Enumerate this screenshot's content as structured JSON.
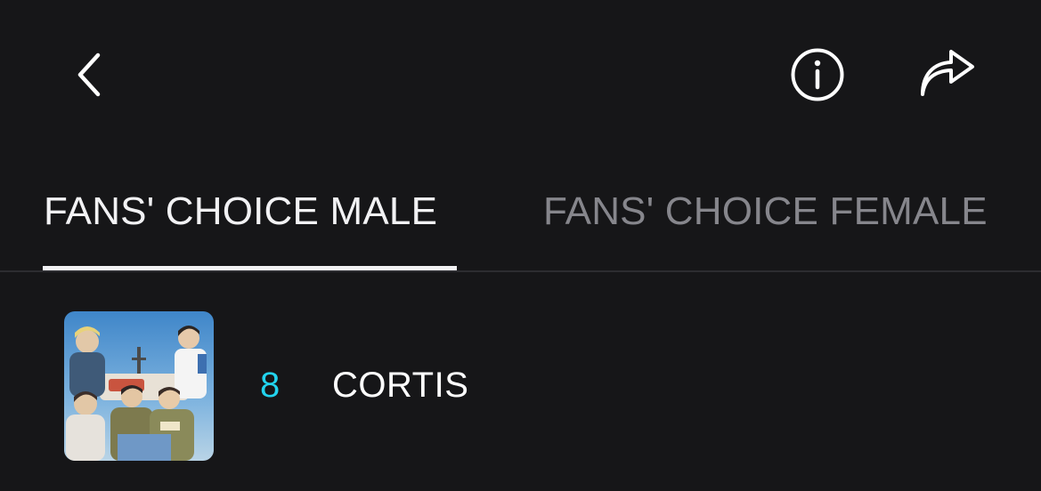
{
  "header": {
    "back_icon": "chevron-left-icon",
    "info_icon": "info-circle-icon",
    "share_icon": "share-arrow-icon"
  },
  "tabs": [
    {
      "label": "FANS' CHOICE MALE",
      "active": true
    },
    {
      "label": "FANS' CHOICE FEMALE",
      "active": false
    }
  ],
  "list": {
    "items": [
      {
        "rank": "8",
        "name": "CORTIS",
        "thumbnail": "group-photo"
      }
    ]
  },
  "colors": {
    "background": "#161618",
    "active_tab": "#f2f2f4",
    "inactive_tab": "#86868c",
    "rank_accent": "#22d3ee",
    "divider": "#2c2c30"
  }
}
